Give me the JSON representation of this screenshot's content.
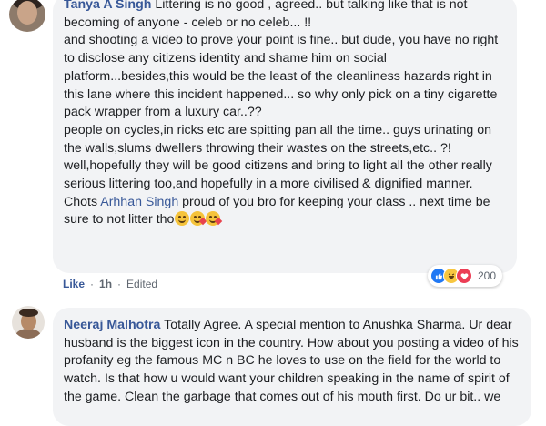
{
  "comment1": {
    "author": "Tanya A Singh",
    "text_before_mention": " Littering is no good , agreed.. but talking like that is not becoming of anyone - celeb or no celeb... !!\nand shooting a video to prove your point is fine.. but dude, you have no right to disclose any citizens identity and shame him on social platform...besides,this would be the least of the cleanliness hazards right in this lane where this incident happened... so why only pick on a tiny cigarette pack wrapper from a luxury car..??\npeople on cycles,in ricks etc are spitting pan all the time.. guys urinating on the walls,slums dwellers throwing their wastes on the streets,etc.. ?!\nwell,hopefully they will be good citizens and bring to light all the other really serious littering too,and hopefully in a more civilised & dignified manner.\nChots ",
    "mention": "Arhhan Singh",
    "text_after_mention": " proud of you bro for keeping your class .. next time be sure to not litter tho",
    "emojis": [
      "smiling-face-icon",
      "kissing-heart-icon",
      "kissing-heart-icon"
    ],
    "reactions": {
      "icons": [
        "like-icon",
        "haha-icon",
        "love-icon"
      ],
      "colors": [
        "#2078f4",
        "#f7c640",
        "#ec3d55"
      ],
      "count": "200"
    },
    "actions": {
      "like": "Like",
      "separator": "·",
      "time": "1h",
      "edited": "Edited"
    }
  },
  "comment2": {
    "author": "Neeraj Malhotra",
    "text": " Totally Agree. A special mention to Anushka Sharma. Ur dear husband is the biggest icon in the country. How about you posting a video of his profanity eg the famous MC n BC he loves to use on the field for the world to watch. Is that how u would want your children speaking in the name of spirit of the game. Clean the garbage that comes out of his mouth first. Do ur bit.. we"
  },
  "colors": {
    "link": "#385898",
    "bubble": "#f2f3f5",
    "meta": "#606770",
    "text": "#1c1e21"
  }
}
